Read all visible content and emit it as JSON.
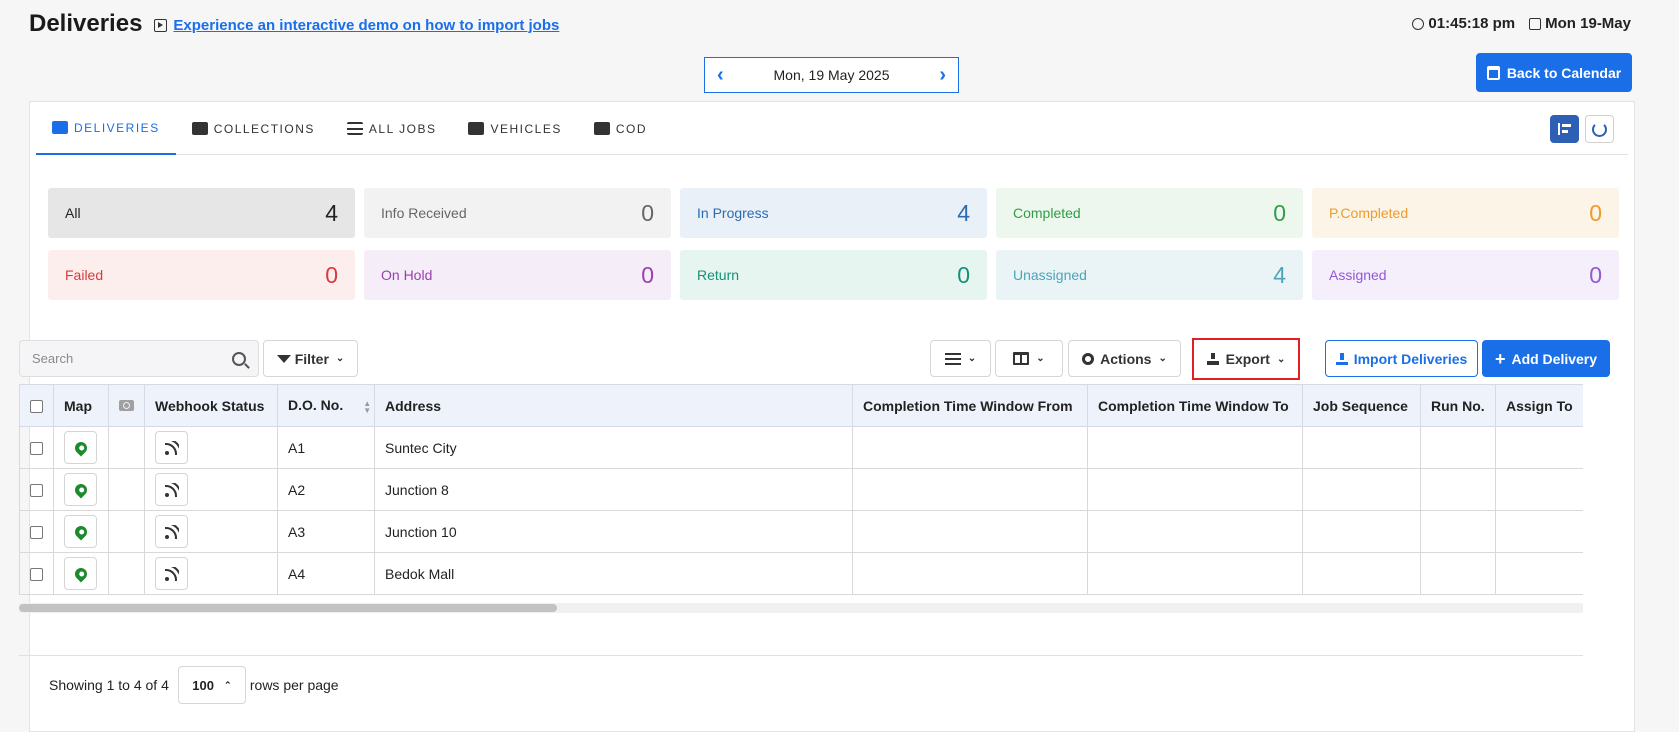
{
  "header": {
    "title": "Deliveries",
    "demo_link": "Experience an interactive demo on how to import jobs",
    "time": "01:45:18 pm",
    "date": "Mon 19-May"
  },
  "date_nav": {
    "date": "Mon, 19 May 2025"
  },
  "back_button": "Back to Calendar",
  "tabs": [
    {
      "label": "DELIVERIES",
      "icon": "truck-icon",
      "active": true
    },
    {
      "label": "COLLECTIONS",
      "icon": "archive-icon",
      "active": false
    },
    {
      "label": "ALL JOBS",
      "icon": "list-icon",
      "active": false
    },
    {
      "label": "VEHICLES",
      "icon": "car-icon",
      "active": false
    },
    {
      "label": "COD",
      "icon": "money-icon",
      "active": false
    }
  ],
  "status_cards": [
    {
      "label": "All",
      "count": "4",
      "bg": "#e6e6e6",
      "color": "#222222"
    },
    {
      "label": "Info Received",
      "count": "0",
      "bg": "#f2f2f2",
      "color": "#666666"
    },
    {
      "label": "In Progress",
      "count": "4",
      "bg": "#e9f0f8",
      "color": "#2b6cb0"
    },
    {
      "label": "Completed",
      "count": "0",
      "bg": "#edf7ee",
      "color": "#2e9e47"
    },
    {
      "label": "P.Completed",
      "count": "0",
      "bg": "#fdf4e8",
      "color": "#ee9a2c"
    },
    {
      "label": "Failed",
      "count": "0",
      "bg": "#fdeeee",
      "color": "#d93a3a"
    },
    {
      "label": "On Hold",
      "count": "0",
      "bg": "#f5edf7",
      "color": "#9b3fb0"
    },
    {
      "label": "Return",
      "count": "0",
      "bg": "#e7f5f1",
      "color": "#139178"
    },
    {
      "label": "Unassigned",
      "count": "4",
      "bg": "#eaf4f6",
      "color": "#4aa5b8"
    },
    {
      "label": "Assigned",
      "count": "0",
      "bg": "#f4effb",
      "color": "#9358d6"
    }
  ],
  "toolbar": {
    "search_placeholder": "Search",
    "filter": "Filter",
    "actions": "Actions",
    "export": "Export",
    "import": "Import Deliveries",
    "add": "Add Delivery"
  },
  "table": {
    "columns": [
      "Map",
      "Webhook Status",
      "D.O. No.",
      "Address",
      "Completion Time Window From",
      "Completion Time Window To",
      "Job Sequence",
      "Run No.",
      "Assign To"
    ],
    "rows": [
      {
        "do_no": "A1",
        "address": "Suntec City"
      },
      {
        "do_no": "A2",
        "address": "Junction 8"
      },
      {
        "do_no": "A3",
        "address": "Junction 10"
      },
      {
        "do_no": "A4",
        "address": "Bedok Mall"
      }
    ]
  },
  "footer": {
    "showing": "Showing 1 to 4 of 4",
    "rows_per_page_value": "100",
    "rows_per_page_label": "rows per page"
  }
}
